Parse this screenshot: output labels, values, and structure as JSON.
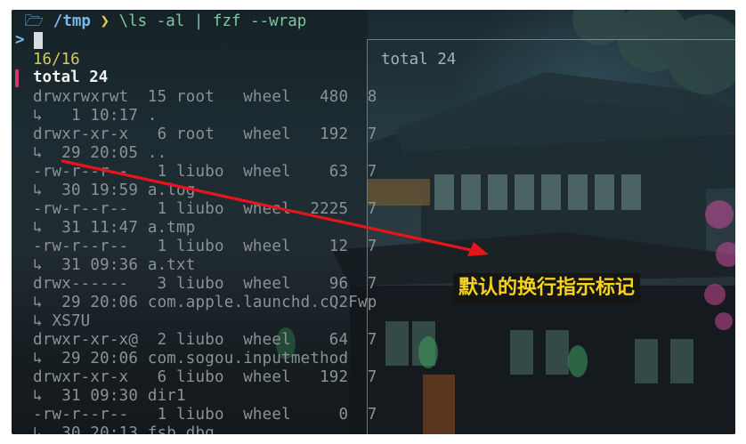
{
  "prompt": {
    "path": "/tmp",
    "separator": "❯",
    "command": "\\ls -al | fzf --wrap"
  },
  "fzf": {
    "prompt_symbol": ">",
    "counter": "16/16",
    "selected_line": "total 24"
  },
  "listing": [
    {
      "kind": "entry",
      "text": "drwxrwxrwt  15 root   wheel   480  8"
    },
    {
      "kind": "wrap",
      "text": "↳   1 10:17 ."
    },
    {
      "kind": "entry",
      "text": "drwxr-xr-x   6 root   wheel   192  7"
    },
    {
      "kind": "wrap",
      "text": "↳  29 20:05 .."
    },
    {
      "kind": "entry",
      "text": "-rw-r--r--   1 liubo  wheel    63  7"
    },
    {
      "kind": "wrap",
      "text": "↳  30 19:59 a.log"
    },
    {
      "kind": "entry",
      "text": "-rw-r--r--   1 liubo  wheel  2225  7"
    },
    {
      "kind": "wrap",
      "text": "↳  31 11:47 a.tmp"
    },
    {
      "kind": "entry",
      "text": "-rw-r--r--   1 liubo  wheel    12  7"
    },
    {
      "kind": "wrap",
      "text": "↳  31 09:36 a.txt"
    },
    {
      "kind": "entry",
      "text": "drwx------   3 liubo  wheel    96  7"
    },
    {
      "kind": "wrap",
      "text": "↳  29 20:06 com.apple.launchd.cQ2Fwp"
    },
    {
      "kind": "wrap",
      "text": "↳ XS7U"
    },
    {
      "kind": "entry",
      "text": "drwxr-xr-x@  2 liubo  wheel    64  7"
    },
    {
      "kind": "wrap",
      "text": "↳  29 20:06 com.sogou.inputmethod"
    },
    {
      "kind": "entry",
      "text": "drwxr-xr-x   6 liubo  wheel   192  7"
    },
    {
      "kind": "wrap",
      "text": "↳  31 09:30 dir1"
    },
    {
      "kind": "entry",
      "text": "-rw-r--r--   1 liubo  wheel     0  7"
    },
    {
      "kind": "wrap",
      "text": "↳  30 20:13 fsb.dbg"
    }
  ],
  "preview": {
    "content": "total 24"
  },
  "annotation": {
    "label": "默认的换行指示标记",
    "arrow_color": "#e8141c",
    "label_color": "#f5d21b"
  },
  "icons": {
    "apple": "apple-icon",
    "folder": "folder-icon"
  }
}
